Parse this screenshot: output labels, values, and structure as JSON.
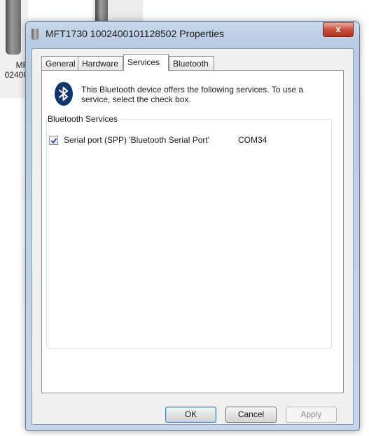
{
  "desktop": {
    "device_label": "MF\n02400"
  },
  "window": {
    "title": "MFT1730 1002400101128502 Properties",
    "close_glyph": "x"
  },
  "tabs": [
    {
      "label": "General"
    },
    {
      "label": "Hardware"
    },
    {
      "label": "Services",
      "selected": true
    },
    {
      "label": "Bluetooth"
    }
  ],
  "services_page": {
    "intro": "This Bluetooth device offers the following services. To use a service, select the check box.",
    "group_label": "Bluetooth Services",
    "services": [
      {
        "name": "Serial port (SPP) 'Bluetooth Serial Port'",
        "port": "COM34",
        "checked": true
      }
    ]
  },
  "buttons": {
    "ok": "OK",
    "cancel": "Cancel",
    "apply": "Apply"
  },
  "colors": {
    "bluetooth_icon": "#12356e",
    "close_button": "#c74f3b"
  }
}
